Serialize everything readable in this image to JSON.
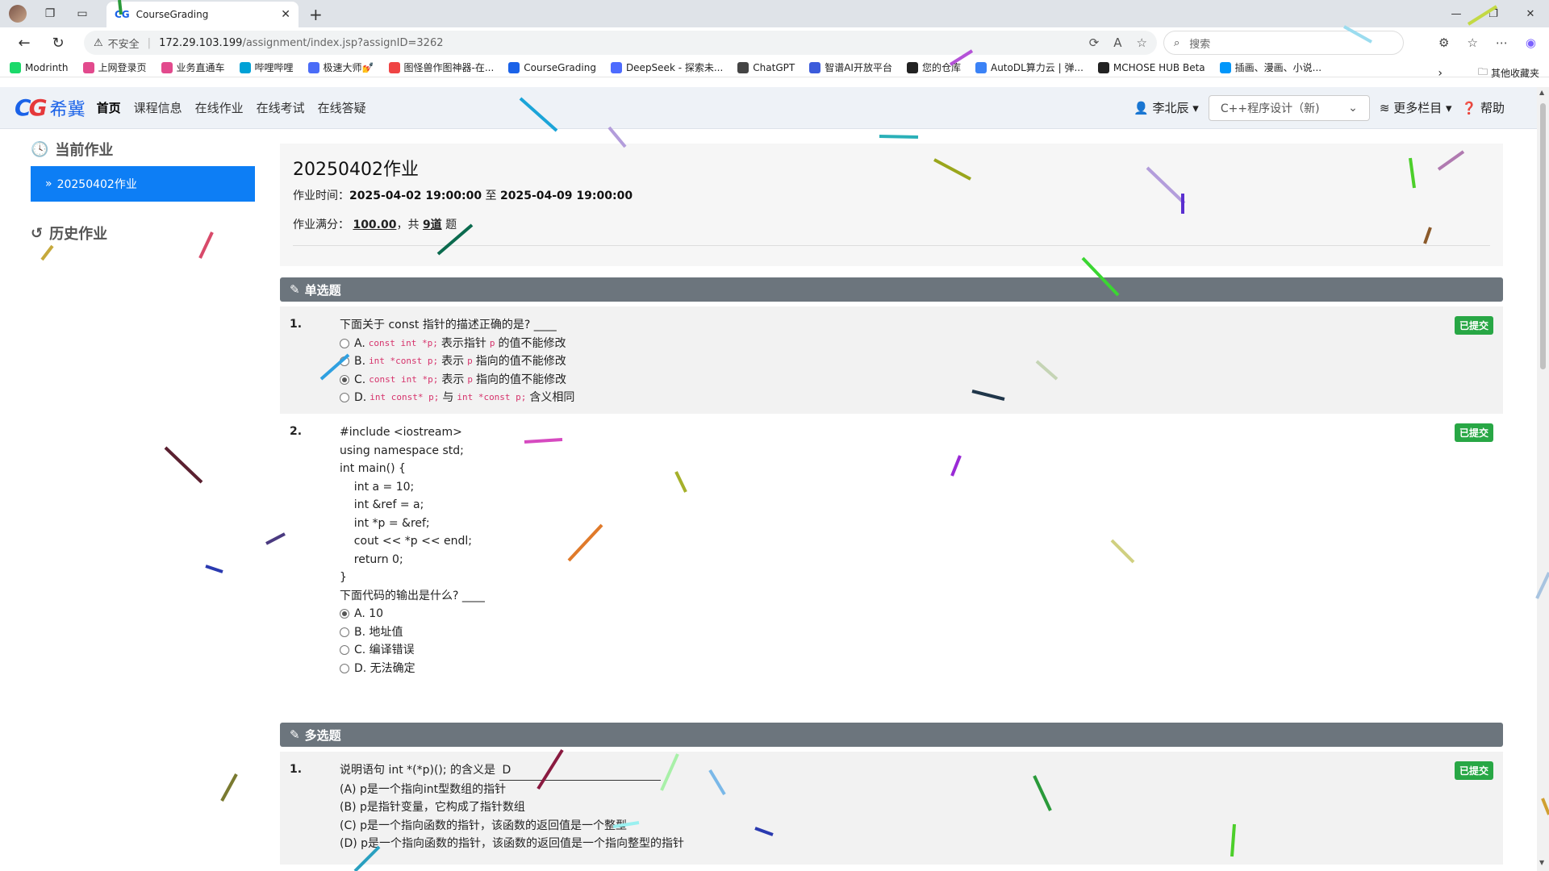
{
  "browser": {
    "tab_title": "CourseGrading",
    "tab_favicon": "CG",
    "insecure_label": "不安全",
    "url_host": "172.29.103.199",
    "url_path": "/assignment/index.jsp?assignID=3262",
    "search_placeholder": "搜索",
    "bookmarks": [
      {
        "label": "Modrinth",
        "color": "#1bd96a"
      },
      {
        "label": "上网登录页",
        "color": "#e24a8d"
      },
      {
        "label": "业务直通车",
        "color": "#e24a8d"
      },
      {
        "label": "哔哩哔哩",
        "color": "#00a1d6"
      },
      {
        "label": "极速大师💅",
        "color": "#4a6cf7"
      },
      {
        "label": "图怪兽作图神器-在...",
        "color": "#ef4444"
      },
      {
        "label": "CourseGrading",
        "color": "#1a62e8"
      },
      {
        "label": "DeepSeek - 探索未...",
        "color": "#4d6bfe"
      },
      {
        "label": "ChatGPT",
        "color": "#444444"
      },
      {
        "label": "智谱AI开放平台",
        "color": "#3b5bdb"
      },
      {
        "label": "您的仓库",
        "color": "#222222"
      },
      {
        "label": "AutoDL算力云 | 弹...",
        "color": "#3b82f6"
      },
      {
        "label": "MCHOSE HUB Beta",
        "color": "#222222"
      },
      {
        "label": "插画、漫画、小说...",
        "color": "#0096fa"
      }
    ],
    "other_favorites": "其他收藏夹"
  },
  "site": {
    "logo_cg": "CG",
    "logo_name": "希冀",
    "nav": [
      "首页",
      "课程信息",
      "在线作业",
      "在线考试",
      "在线答疑"
    ],
    "user": "李北辰",
    "course": "C++程序设计（新)",
    "more": "更多栏目",
    "help": "帮助"
  },
  "sidebar": {
    "current_heading": "当前作业",
    "current_item": "20250402作业",
    "history_heading": "历史作业"
  },
  "homework": {
    "title": "20250402作业",
    "time_label": "作业时间：",
    "start": "2025-04-02 19:00:00",
    "to": "至",
    "end": "2025-04-09 19:00:00",
    "score_label": "作业满分：",
    "score": "100.00",
    "count_prefix": "，共",
    "count": "9道",
    "count_suffix": "题"
  },
  "single_choice": {
    "heading": "单选题",
    "questions": [
      {
        "num": "1.",
        "stem": "下面关于 const 指针的描述正确的是?",
        "blank": "____",
        "badge": "已提交",
        "options": [
          {
            "prefix": "A.",
            "code1": "const int *p;",
            "t1": "表示指针",
            "code2": "p",
            "t2": "的值不能修改",
            "code3": "",
            "t3": "",
            "selected": false
          },
          {
            "prefix": "B.",
            "code1": "int *const p;",
            "t1": "表示",
            "code2": "p",
            "t2": "指向的值不能修改",
            "code3": "",
            "t3": "",
            "selected": false
          },
          {
            "prefix": "C.",
            "code1": "const int *p;",
            "t1": "表示",
            "code2": "p",
            "t2": "指向的值不能修改",
            "code3": "",
            "t3": "",
            "selected": true
          },
          {
            "prefix": "D.",
            "code1": "int const* p;",
            "t1": "与",
            "code2": "int *const p;",
            "t2": "含义相同",
            "code3": "",
            "t3": "",
            "selected": false
          }
        ]
      },
      {
        "num": "2.",
        "badge": "已提交",
        "code_lines": [
          "#include <iostream>",
          "using namespace std;",
          "int main() {",
          "    int a = 10;",
          "    int &ref = a;",
          "    int *p = &ref;",
          "    cout << *p << endl;",
          "    return 0;",
          "}"
        ],
        "stem": "下面代码的输出是什么?",
        "blank": "____",
        "options": [
          {
            "label": "A. 10",
            "selected": true
          },
          {
            "label": "B. 地址值",
            "selected": false
          },
          {
            "label": "C. 编译错误",
            "selected": false
          },
          {
            "label": "D. 无法确定",
            "selected": false
          }
        ]
      }
    ]
  },
  "multi_choice": {
    "heading": "多选题",
    "questions": [
      {
        "num": "1.",
        "stem": "说明语句 int *(*p)(); 的含义是",
        "answer": "D",
        "badge": "已提交",
        "lines": [
          "(A) p是一个指向int型数组的指针",
          "(B) p是指针变量，它构成了指针数组",
          "(C) p是一个指向函数的指针，该函数的返回值是一个整型",
          "(D) p是一个指向函数的指针，该函数的返回值是一个指向整型的指针"
        ]
      }
    ]
  }
}
